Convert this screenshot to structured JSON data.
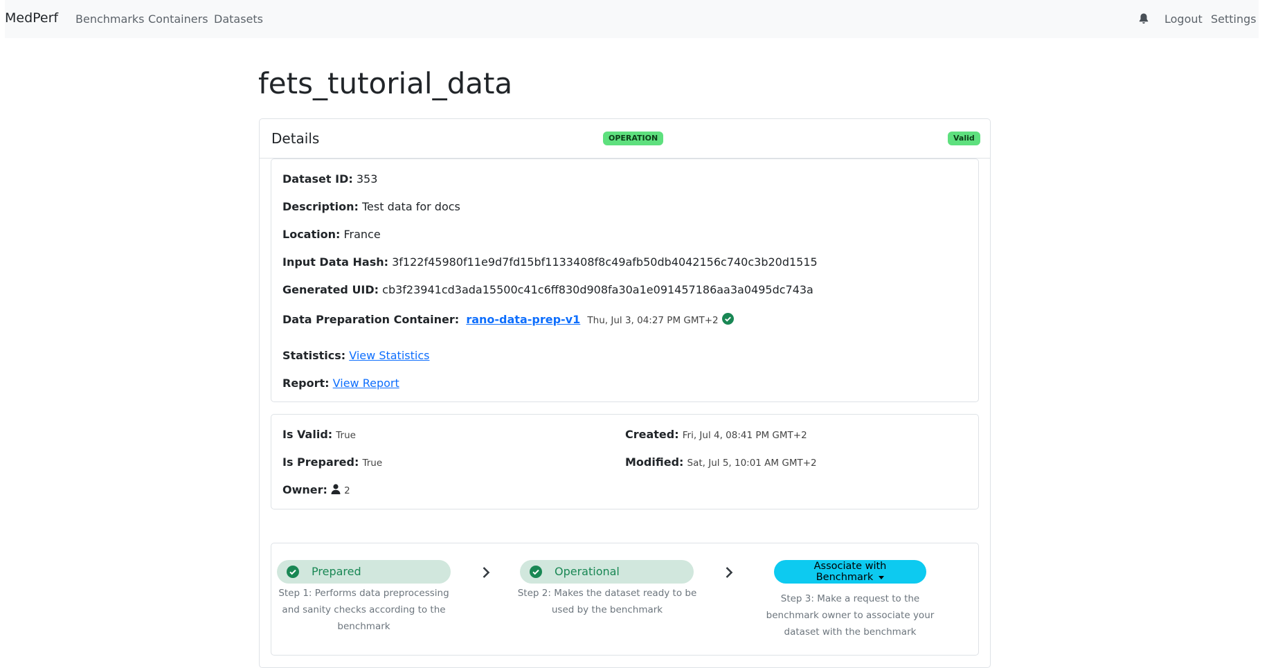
{
  "nav": {
    "brand": "MedPerf",
    "links": [
      "Benchmarks",
      "Containers",
      "Datasets"
    ],
    "logout": "Logout",
    "settings": "Settings"
  },
  "page": {
    "title": "fets_tutorial_data"
  },
  "details": {
    "title": "Details",
    "badge_stage": "OPERATION",
    "badge_status": "Valid",
    "dataset_id_label": "Dataset ID:",
    "dataset_id": "353",
    "description_label": "Description:",
    "description": "Test data for docs",
    "location_label": "Location:",
    "location": "France",
    "input_hash_label": "Input Data Hash:",
    "input_hash": "3f122f45980f11e9d7fd15bf1133408f8c49afb50db4042156c740c3b20d1515",
    "generated_uid_label": "Generated UID:",
    "generated_uid": "cb3f23941cd3ada15500c41c6ff830d908fa30a1e091457186aa3a0495dc743a",
    "prep_container_label": "Data Preparation Container:",
    "prep_container": "rano-data-prep-v1",
    "prep_container_date": "Thu, Jul 3, 04:27 PM GMT+2",
    "statistics_label": "Statistics:",
    "statistics_link": "View Statistics",
    "report_label": "Report:",
    "report_link": "View Report"
  },
  "meta": {
    "is_valid_label": "Is Valid:",
    "is_valid": "True",
    "is_prepared_label": "Is Prepared:",
    "is_prepared": "True",
    "owner_label": "Owner:",
    "owner": "2",
    "created_label": "Created:",
    "created": "Fri, Jul 4, 08:41 PM GMT+2",
    "modified_label": "Modified:",
    "modified": "Sat, Jul 5, 10:01 AM GMT+2"
  },
  "steps": {
    "step1_label": "Prepared",
    "step1_desc_l1": "Step 1: Performs data preprocessing",
    "step1_desc_l2": "and sanity checks according to the",
    "step1_desc_l3": "benchmark",
    "step2_label": "Operational",
    "step2_desc_l1": "Step 2: Makes the dataset ready to be",
    "step2_desc_l2": "used by the benchmark",
    "step3_button": "Associate with Benchmark",
    "step3_desc_l1": "Step 3: Make a request to the",
    "step3_desc_l2": "benchmark owner to associate your",
    "step3_desc_l3": "dataset with the benchmark"
  },
  "colors": {
    "badge_green": "#5ee07e",
    "success": "#198754",
    "step_bg": "#d1e7dd",
    "link": "#0d6efd",
    "button_info": "#0dcaf0"
  },
  "icons": [
    "bell-icon",
    "check-circle-icon",
    "user-icon",
    "chevron-right-icon",
    "caret-down-icon"
  ]
}
